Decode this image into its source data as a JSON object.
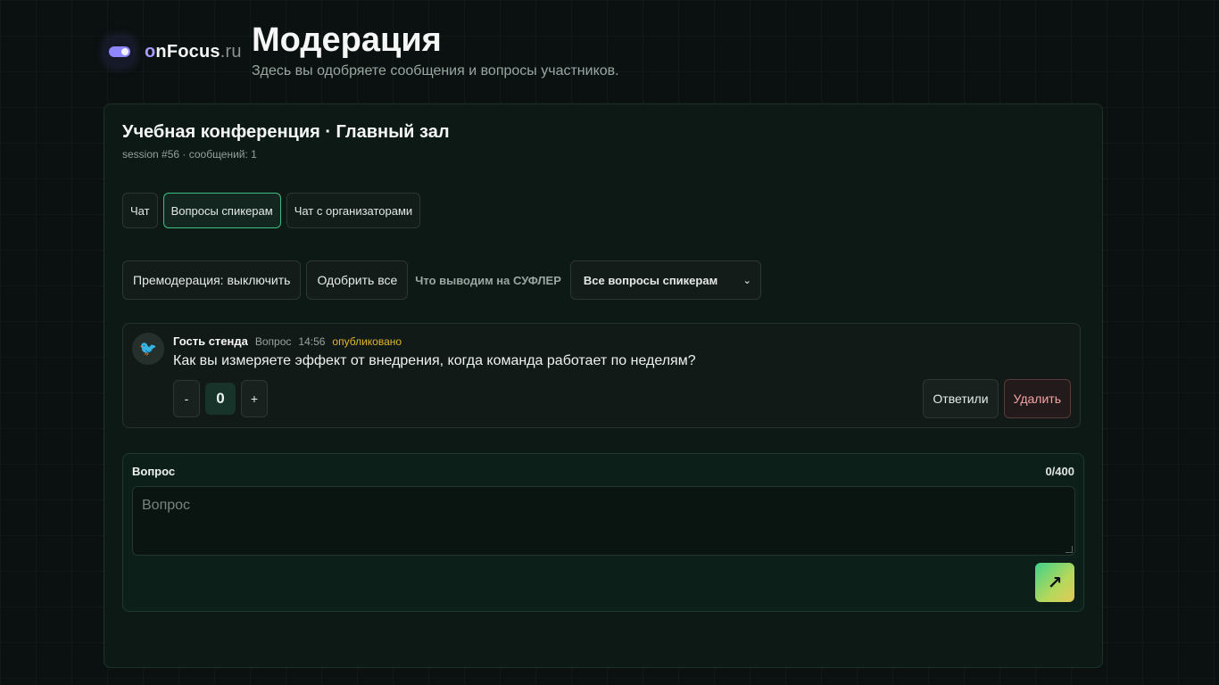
{
  "logo": {
    "prefix": "o",
    "name": "nFocus",
    "tld": ".ru"
  },
  "header": {
    "title": "Модерация",
    "subtitle": "Здесь вы одобряете сообщения и вопросы участников."
  },
  "conference": {
    "title": "Учебная конференция · Главный зал",
    "meta": "session #56 · сообщений: 1"
  },
  "tabs": [
    {
      "label": "Чат",
      "active": false
    },
    {
      "label": "Вопросы спикерам",
      "active": true
    },
    {
      "label": "Чат с организаторами",
      "active": false
    }
  ],
  "controls": {
    "premoderation_label": "Премодерация: выключить",
    "approve_all_label": "Одобрить все",
    "prompter_label": "Что выводим на СУФЛЕР",
    "prompter_value": "Все вопросы спикерам"
  },
  "message": {
    "author": "Гость стенда",
    "type": "Вопрос",
    "time": "14:56",
    "status": "опубликовано",
    "text": "Как вы измеряете эффект от внедрения, когда команда работает по неделям?",
    "votes": "0",
    "minus_label": "-",
    "plus_label": "+",
    "answered_label": "Ответили",
    "delete_label": "Удалить",
    "avatar_emoji": "🐦"
  },
  "form": {
    "label": "Вопрос",
    "counter": "0/400",
    "placeholder": "Вопрос",
    "send_icon": "↗"
  },
  "colors": {
    "accent": "#3fbf85",
    "status": "#e0b62d",
    "danger": "#f1a6a6",
    "brand": "#a59dff"
  }
}
